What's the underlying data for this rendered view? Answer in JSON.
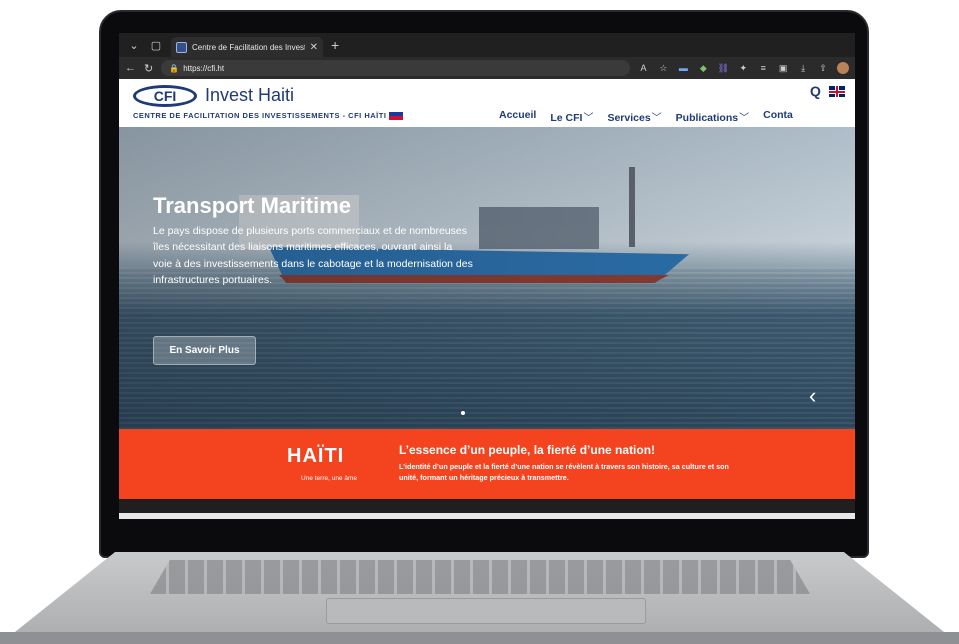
{
  "browser": {
    "tab_title": "Centre de Facilitation des Investisse",
    "tab_close": "✕",
    "new_tab": "+",
    "url": "https://cfi.ht"
  },
  "site": {
    "logo_cfi": "CFI",
    "brand": "Invest Haiti",
    "subtitle": "CENTRE DE FACILITATION DES INVESTISSEMENTS - CFI HAÏTI",
    "nav": [
      {
        "label": "Accueil"
      },
      {
        "label": "Le CFI"
      },
      {
        "label": "Services"
      },
      {
        "label": "Publications"
      },
      {
        "label": "Conta"
      }
    ]
  },
  "hero": {
    "title": "Transport Maritime",
    "text": "Le pays dispose de plusieurs ports commerciaux et de nombreuses îles nécessitant des liaisons maritimes efficaces, ouvrant ainsi la voie à des investissements dans le cabotage et la modernisation des infrastructures portuaires.",
    "button": "En Savoir Plus"
  },
  "banner": {
    "logo": "HAÏTI",
    "tagline": "Une terre, une âme",
    "title": "L’essence d’un peuple, la fierté d’une nation!",
    "text": "L’identité d’un peuple et la fierté d’une nation se révèlent à travers son histoire, sa culture et son unité, formant un héritage précieux à transmettre."
  },
  "colors": {
    "brand_blue": "#1f3a78",
    "banner_orange": "#f4431f"
  }
}
